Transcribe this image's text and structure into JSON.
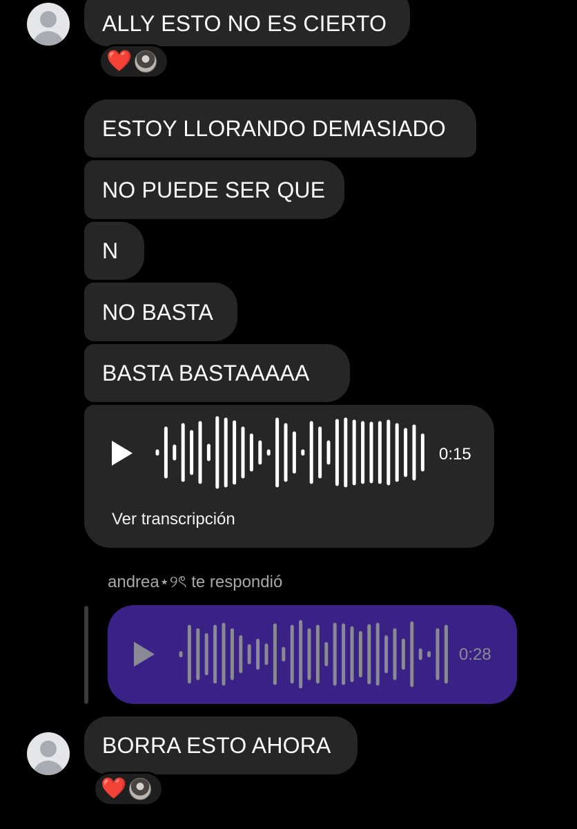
{
  "messages": {
    "m1": "ALLY ESTO NO ES CIERTO",
    "m2": "ESTOY LLORANDO DEMASIADO",
    "m3": "NO PUEDE SER QUE",
    "m4": "N",
    "m5": "NO BASTA",
    "m6": "BASTA BASTAAAAA",
    "m7": "BORRA ESTO AHORA"
  },
  "reactions": {
    "r1_emoji": "❤️",
    "r2_emoji": "❤️"
  },
  "voice_message": {
    "duration": "0:15",
    "transcript_link": "Ver transcripción"
  },
  "reply": {
    "label": "andrea⋆୨ৎ te respondió",
    "duration": "0:28",
    "bubble_color": "#3a2185"
  },
  "colors": {
    "background": "#000000",
    "bubble": "#262626",
    "heart": "#e8112d"
  }
}
